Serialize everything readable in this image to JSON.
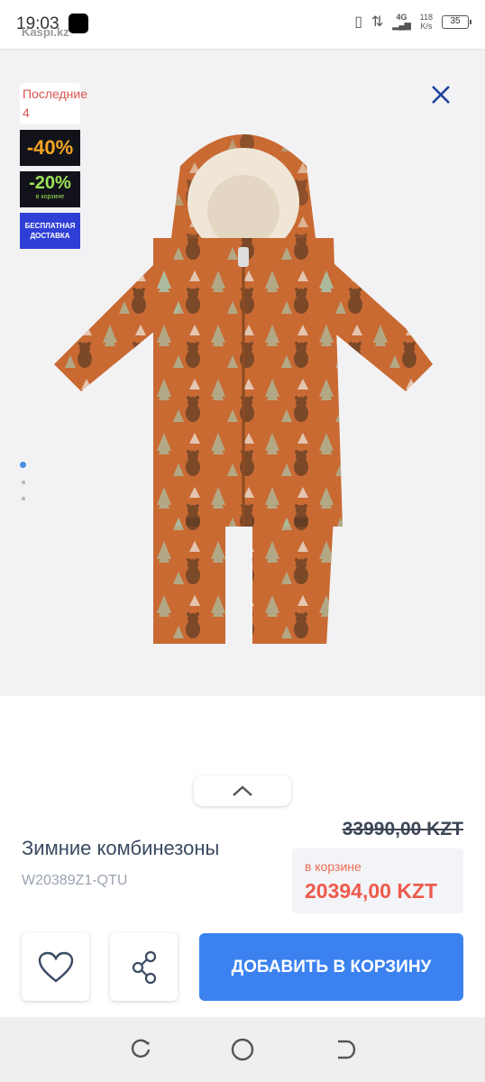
{
  "status_bar": {
    "time": "19:03",
    "network": "4G",
    "speed_value": "118",
    "speed_unit": "K/s",
    "battery": "35",
    "watermark": "Kaspi.kz"
  },
  "badges": {
    "stock": "Последние 4",
    "discount": "-40%",
    "cart_discount": "-20%",
    "cart_discount_sub": "в корзине",
    "free_shipping": "БЕСПЛАТНАЯ ДОСТАВКА"
  },
  "gallery": {
    "image_label": "Зимние комбинезоны",
    "total_images": 3,
    "active_index": 0
  },
  "product": {
    "title": "Зимние комбинезоны",
    "sku": "W20389Z1-QTU",
    "old_price": "33990,00 KZT",
    "cart_price_label": "в корзине",
    "cart_price": "20394,00 KZT"
  },
  "actions": {
    "add_to_cart": "ДОБАВИТЬ В КОРЗИНУ"
  },
  "colors": {
    "accent": "#3b82f0",
    "price": "#ee5a4b",
    "garment": "#c96a33"
  }
}
